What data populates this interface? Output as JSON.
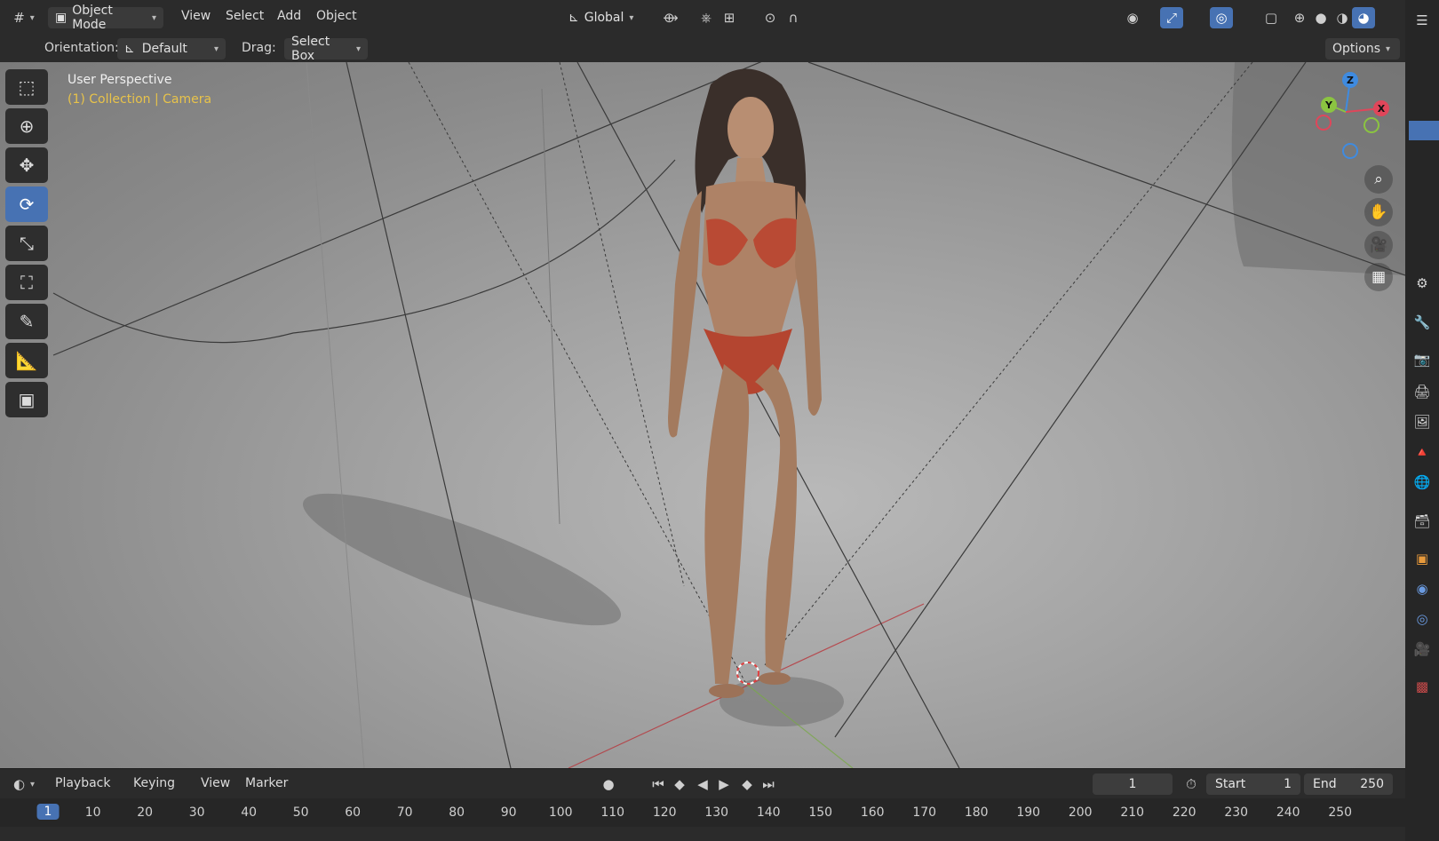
{
  "header": {
    "editor_icon": "grid-icon",
    "mode": "Object Mode",
    "menus": [
      "View",
      "Select",
      "Add",
      "Object"
    ],
    "transform_orientation": "Global",
    "options_label": "Options"
  },
  "tool_settings": {
    "orientation_label": "Orientation:",
    "orientation_value": "Default",
    "drag_label": "Drag:",
    "drag_value": "Select Box"
  },
  "viewport": {
    "title": "User Perspective",
    "subtitle": "(1) Collection | Camera",
    "gizmo_axes": {
      "z": "Z",
      "y": "Y",
      "x": "X"
    }
  },
  "toolbar": {
    "tools": [
      "select-box-icon",
      "cursor-icon",
      "move-icon",
      "rotate-icon",
      "scale-icon",
      "transform-icon",
      "annotate-icon",
      "measure-icon",
      "add-cube-icon"
    ],
    "active_tool": "rotate-icon"
  },
  "timeline": {
    "menus": [
      "Playback",
      "Keying",
      "View",
      "Marker"
    ],
    "current_frame": "1",
    "start_label": "Start",
    "start_value": "1",
    "end_label": "End",
    "end_value": "250",
    "ruler": [
      "1",
      "10",
      "20",
      "30",
      "40",
      "50",
      "60",
      "70",
      "80",
      "90",
      "100",
      "110",
      "120",
      "130",
      "140",
      "150",
      "160",
      "170",
      "180",
      "190",
      "200",
      "210",
      "220",
      "230",
      "240",
      "250"
    ]
  },
  "colors": {
    "accent": "#4772b3",
    "overlay_text": "#e8c34a",
    "axis_x": "#e0465a",
    "axis_y": "#8bc441",
    "axis_z": "#3f8be0"
  }
}
